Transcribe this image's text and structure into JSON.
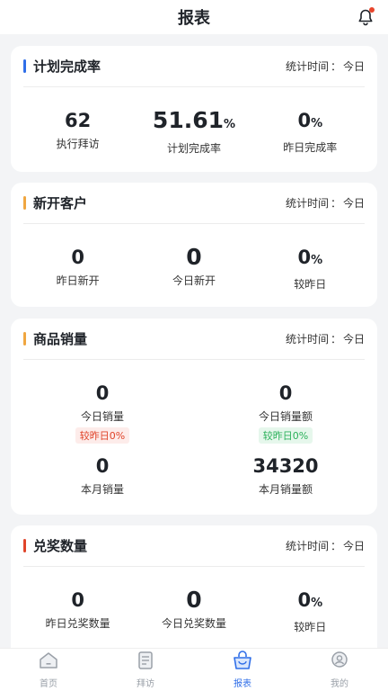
{
  "header": {
    "title": "报表",
    "bell_icon": "bell-icon"
  },
  "colors": {
    "accent_blue": "#2f6ee8",
    "orange": "#f0a640",
    "red": "#e0442a",
    "green": "#2bb15a"
  },
  "plan_completion": {
    "title": "计划完成率",
    "time_label": "统计时间",
    "time_value": "今日",
    "stats": [
      {
        "value": "62",
        "unit": "",
        "label": "执行拜访"
      },
      {
        "value": "51.61",
        "unit": "%",
        "label": "计划完成率"
      },
      {
        "value": "0",
        "unit": "%",
        "label": "昨日完成率"
      }
    ]
  },
  "new_customers": {
    "title": "新开客户",
    "time_label": "统计时间",
    "time_value": "今日",
    "stats": [
      {
        "value": "0",
        "unit": "",
        "label": "昨日新开"
      },
      {
        "value": "0",
        "unit": "",
        "label": "今日新开"
      },
      {
        "value": "0",
        "unit": "%",
        "label": "较昨日"
      }
    ]
  },
  "product_sales": {
    "title": "商品销量",
    "time_label": "统计时间",
    "time_value": "今日",
    "stats": [
      {
        "value": "0",
        "label": "今日销量",
        "badge": "较昨日0%"
      },
      {
        "value": "0",
        "label": "今日销量额",
        "badge": "较昨日0%"
      },
      {
        "value": "0",
        "label": "本月销量"
      },
      {
        "value": "34320",
        "label": "本月销量额"
      }
    ]
  },
  "redemptions": {
    "title": "兑奖数量",
    "time_label": "统计时间",
    "time_value": "今日",
    "stats": [
      {
        "value": "0",
        "unit": "",
        "label": "昨日兑奖数量"
      },
      {
        "value": "0",
        "unit": "",
        "label": "今日兑奖数量"
      },
      {
        "value": "0",
        "unit": "%",
        "label": "较昨日"
      }
    ]
  },
  "tabbar": {
    "items": [
      {
        "label": "首页",
        "icon": "home-icon"
      },
      {
        "label": "拜访",
        "icon": "visit-list-icon"
      },
      {
        "label": "报表",
        "icon": "report-bag-icon",
        "active": true
      },
      {
        "label": "我的",
        "icon": "profile-icon"
      }
    ]
  }
}
